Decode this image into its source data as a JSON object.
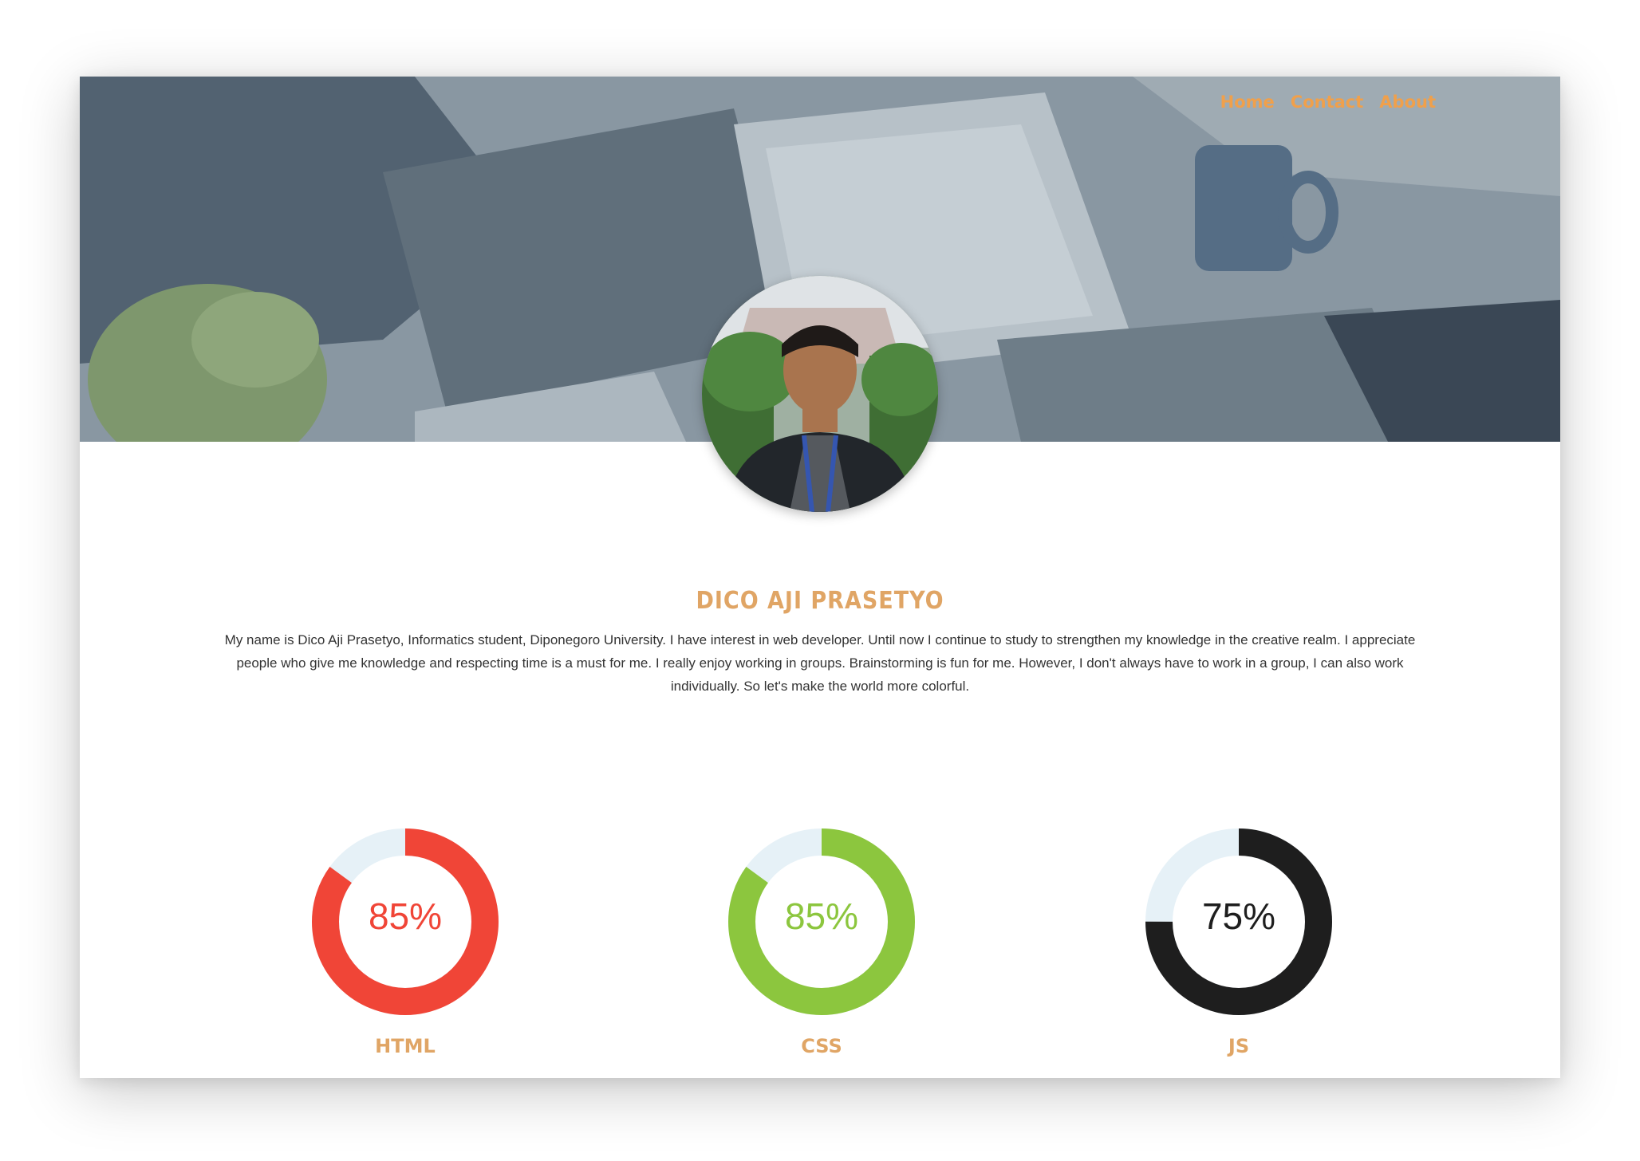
{
  "nav": {
    "items": [
      {
        "label": "Home"
      },
      {
        "label": "Contact"
      },
      {
        "label": "About"
      }
    ]
  },
  "profile": {
    "name": "DICO AJI PRASETYO",
    "bio": "My name is Dico Aji Prasetyo, Informatics student, Diponegoro University. I have interest in web developer. Until now I continue to study to strengthen my knowledge in the creative realm. I appreciate people who give me knowledge and respecting time is a must for me. I really enjoy working in groups. Brainstorming is fun for me. However, I don't always have to work in a group, I can also work individually. So let's make the world more colorful."
  },
  "skills": [
    {
      "label": "HTML",
      "percent_text": "85%",
      "percent": 85,
      "color": "#f04537"
    },
    {
      "label": "CSS",
      "percent_text": "85%",
      "percent": 85,
      "color": "#8cc63e"
    },
    {
      "label": "JS",
      "percent_text": "75%",
      "percent": 75,
      "color": "#1e1e1e"
    }
  ],
  "colors": {
    "accent": "#e0a565",
    "nav": "#f0a04b",
    "track": "#e6f1f7"
  }
}
